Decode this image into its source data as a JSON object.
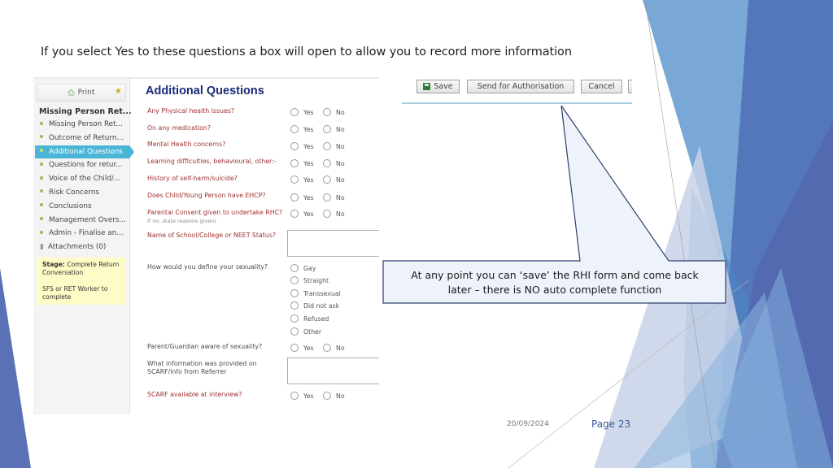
{
  "slide": {
    "title": "If you select Yes to these questions a box will open to allow you to record more information",
    "date": "20/09/2024",
    "page": "Page 23",
    "colors": {
      "accent_dark": "#4f6bb0",
      "accent_mid": "#5b8fc4",
      "accent_light": "#a9c3e3",
      "callout_border": "#2e3f6e",
      "callout_fill": "#eef3fb"
    }
  },
  "sidebar": {
    "print_label": "Print",
    "heading": "Missing Person Ret...",
    "items": [
      {
        "label": "Missing Person Ret...",
        "active": false
      },
      {
        "label": "Outcome of Return...",
        "active": false
      },
      {
        "label": "Additional Questions",
        "active": true
      },
      {
        "label": "Questions for retur...",
        "active": false
      },
      {
        "label": "Voice of the Child/...",
        "active": false
      },
      {
        "label": "Risk Concerns",
        "active": false
      },
      {
        "label": "Conclusions",
        "active": false
      },
      {
        "label": "Management Overs...",
        "active": false
      },
      {
        "label": "Admin - Finalise an...",
        "active": false
      }
    ],
    "attachments_label": "Attachments (0)",
    "stage": {
      "label": "Stage:",
      "value": "Complete Return Conversation",
      "note": "SFS or RET Worker to complete"
    }
  },
  "form": {
    "title": "Additional Questions",
    "yes_label": "Yes",
    "no_label": "No",
    "questions": [
      {
        "text": "Any Physical health issues?"
      },
      {
        "text": "On any medication?"
      },
      {
        "text": "Mental Health concerns?"
      },
      {
        "text": "Learning difficulties, behavioural, other:-"
      },
      {
        "text": "History of self-harm/suicide?"
      },
      {
        "text": "Does Child/Young Person have EHCP?"
      },
      {
        "text": "Parental Consent given to undertake RHC?",
        "sub": "If no, state reasons given)"
      },
      {
        "text": "Name of School/College or NEET Status?"
      },
      {
        "text": "How would you define your sexuality?"
      },
      {
        "text": "Parent/Guardian aware of sexuality?"
      },
      {
        "text": "What information was provided on",
        "text2": "SCARF/info from Referrer"
      },
      {
        "text": "SCARF available at interview?"
      }
    ],
    "sexuality_options": [
      "Gay",
      "Straight",
      "Transsexual",
      "Did not ask",
      "Refused",
      "Other"
    ]
  },
  "toolbar": {
    "save_label": "Save",
    "send_label": "Send for Authorisation",
    "cancel_label": "Cancel"
  },
  "callout": {
    "line1": "At any point you can ‘save’ the RHI form and come back",
    "line2": "later – there is NO auto complete function"
  }
}
